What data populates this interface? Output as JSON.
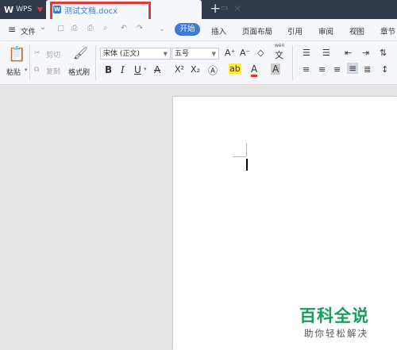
{
  "titlebar": {
    "app_logo": "W",
    "app_name": "WPS",
    "doc_tab_icon": "W",
    "doc_tab_label": "测试文档.docx",
    "close_glyph": "✕",
    "new_tab_glyph": "+"
  },
  "menu": {
    "hamburger": "≡",
    "file": "文件",
    "file_caret": "⌄",
    "start": "开始",
    "insert": "插入",
    "layout": "页面布局",
    "references": "引用",
    "review": "审阅",
    "view": "视图",
    "section": "章节"
  },
  "ribbon": {
    "paste": "粘贴",
    "cut": "剪切",
    "copy": "复制",
    "format_painter": "格式刷",
    "font_name": "宋体 (正文)",
    "font_size": "五号",
    "grow": "A⁺",
    "shrink": "A⁻",
    "bold": "B",
    "italic": "I",
    "underline": "U",
    "strike": "A",
    "superscript": "X²",
    "subscript": "X₂",
    "pinyin": "wén",
    "pinyin_char": "文"
  },
  "watermark": {
    "title": "百科全说",
    "subtitle": "助你轻松解决"
  },
  "colors": {
    "accent": "#3d7cd6",
    "highlight_box": "#e53935",
    "titlebar": "#303a4a",
    "watermark": "#1c9c5c"
  }
}
